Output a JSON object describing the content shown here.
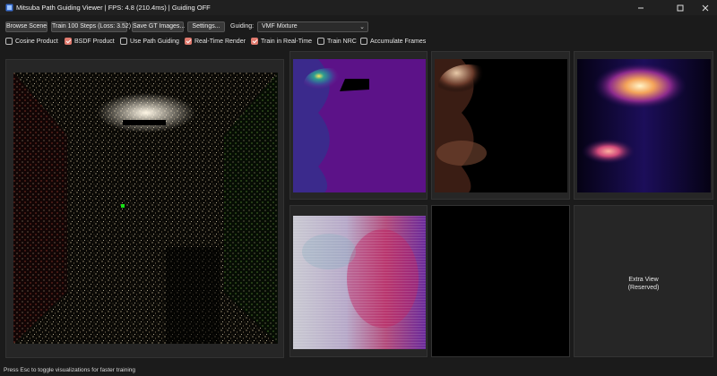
{
  "window": {
    "title": "Mitsuba Path Guiding Viewer | FPS: 4.8 (210.4ms) | Guiding OFF",
    "controls": [
      "minimize",
      "maximize",
      "close"
    ]
  },
  "toolbar": {
    "browse_label": "Browse Scene",
    "train_label": "Train 100 Steps (Loss: 3.52)",
    "save_gt_label": "Save GT Images...",
    "settings_label": "Settings...",
    "guiding_label": "Guiding:",
    "guiding_value": "VMF Mixture"
  },
  "options": [
    {
      "label": "Cosine Product",
      "checked": false
    },
    {
      "label": "BSDF Product",
      "checked": true
    },
    {
      "label": "Use Path Guiding",
      "checked": false
    },
    {
      "label": "Real-Time Render",
      "checked": true
    },
    {
      "label": "Train in Real-Time",
      "checked": true
    },
    {
      "label": "Train NRC",
      "checked": false
    },
    {
      "label": "Accumulate Frames",
      "checked": false
    }
  ],
  "views": {
    "extra_view_label": "Extra View",
    "extra_view_sub": "(Reserved)"
  },
  "status_text": "Press Esc to toggle visualizations for faster training",
  "colors": {
    "accent": "#e07a6e",
    "background": "#1b1b1b",
    "pane": "#262626"
  }
}
